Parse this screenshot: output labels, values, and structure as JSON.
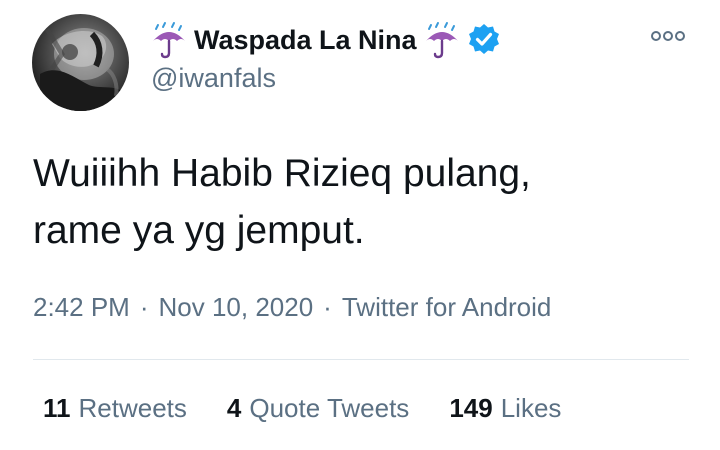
{
  "user": {
    "display_name": "Waspada La Nina",
    "handle": "@iwanfals",
    "name_prefix_icon": "umbrella-with-rain-icon",
    "name_suffix_icon": "umbrella-with-rain-icon",
    "verified_icon": "verified-badge-icon"
  },
  "tweet": {
    "text": "Wuiiihh Habib Rizieq pulang,\nrame ya yg jemput.",
    "time": "2:42 PM",
    "date": "Nov 10, 2020",
    "source": "Twitter for Android",
    "separator": "·"
  },
  "stats": {
    "retweets_count": "11",
    "retweets_label": "Retweets",
    "quote_tweets_count": "4",
    "quote_tweets_label": "Quote Tweets",
    "likes_count": "149",
    "likes_label": "Likes"
  },
  "more_icon": "more-options-icon",
  "colors": {
    "text_primary": "#0f1419",
    "text_secondary": "#5b7083",
    "verified_blue": "#1da1f2",
    "umbrella_purple": "#9b59b6",
    "divider": "#e1e8ed"
  }
}
